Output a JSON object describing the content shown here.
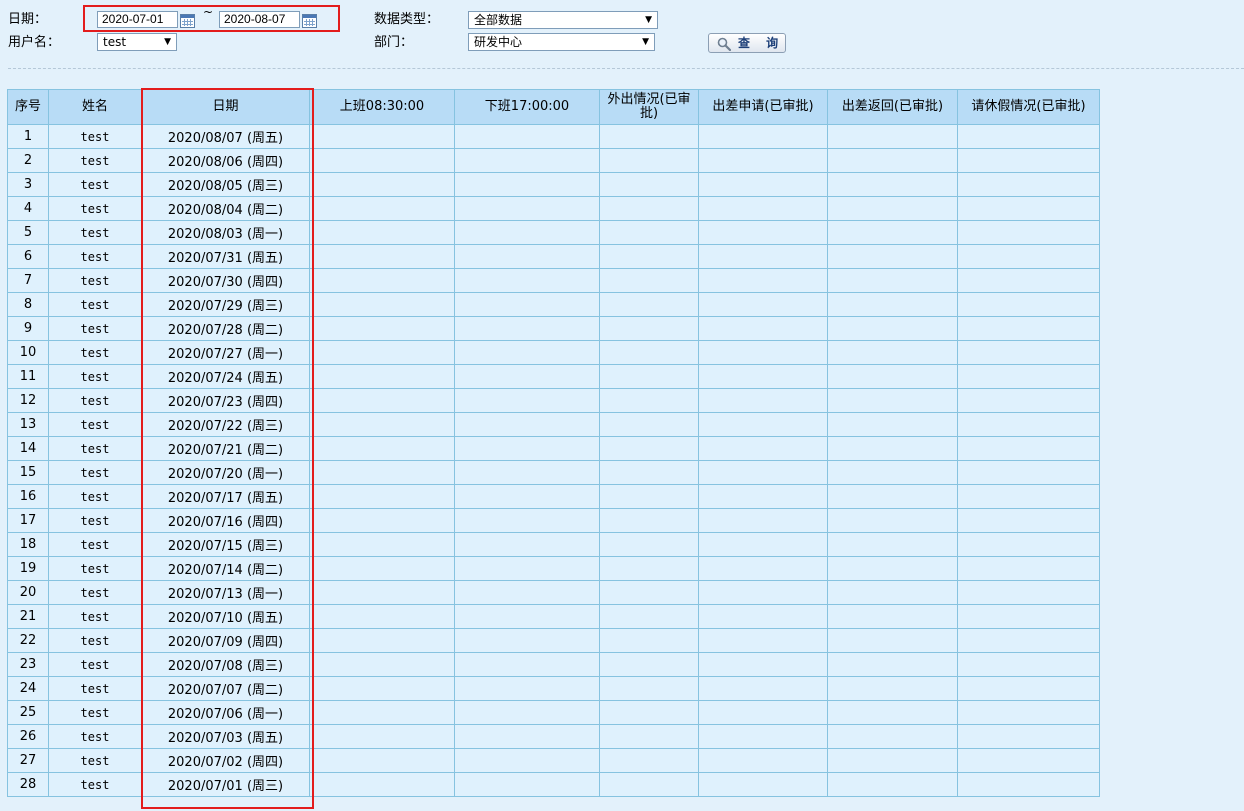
{
  "filters": {
    "date_label": "日期：",
    "start_date": "2020-07-01",
    "date_separator": "~",
    "end_date": "2020-08-07",
    "user_label": "用户名：",
    "user_value": "test",
    "data_type_label": "数据类型：",
    "data_type_value": "全部数据",
    "department_label": "部门：",
    "department_value": "研发中心",
    "query_button": "查 询"
  },
  "table": {
    "headers": [
      "序号",
      "姓名",
      "日期",
      "上班08:30:00",
      "下班17:00:00",
      "外出情况(已审批)",
      "出差申请(已审批)",
      "出差返回(已审批)",
      "请休假情况(已审批)"
    ],
    "rows": [
      [
        "1",
        "test",
        "2020/08/07 (周五)"
      ],
      [
        "2",
        "test",
        "2020/08/06 (周四)"
      ],
      [
        "3",
        "test",
        "2020/08/05 (周三)"
      ],
      [
        "4",
        "test",
        "2020/08/04 (周二)"
      ],
      [
        "5",
        "test",
        "2020/08/03 (周一)"
      ],
      [
        "6",
        "test",
        "2020/07/31 (周五)"
      ],
      [
        "7",
        "test",
        "2020/07/30 (周四)"
      ],
      [
        "8",
        "test",
        "2020/07/29 (周三)"
      ],
      [
        "9",
        "test",
        "2020/07/28 (周二)"
      ],
      [
        "10",
        "test",
        "2020/07/27 (周一)"
      ],
      [
        "11",
        "test",
        "2020/07/24 (周五)"
      ],
      [
        "12",
        "test",
        "2020/07/23 (周四)"
      ],
      [
        "13",
        "test",
        "2020/07/22 (周三)"
      ],
      [
        "14",
        "test",
        "2020/07/21 (周二)"
      ],
      [
        "15",
        "test",
        "2020/07/20 (周一)"
      ],
      [
        "16",
        "test",
        "2020/07/17 (周五)"
      ],
      [
        "17",
        "test",
        "2020/07/16 (周四)"
      ],
      [
        "18",
        "test",
        "2020/07/15 (周三)"
      ],
      [
        "19",
        "test",
        "2020/07/14 (周二)"
      ],
      [
        "20",
        "test",
        "2020/07/13 (周一)"
      ],
      [
        "21",
        "test",
        "2020/07/10 (周五)"
      ],
      [
        "22",
        "test",
        "2020/07/09 (周四)"
      ],
      [
        "23",
        "test",
        "2020/07/08 (周三)"
      ],
      [
        "24",
        "test",
        "2020/07/07 (周二)"
      ],
      [
        "25",
        "test",
        "2020/07/06 (周一)"
      ],
      [
        "26",
        "test",
        "2020/07/03 (周五)"
      ],
      [
        "27",
        "test",
        "2020/07/02 (周四)"
      ],
      [
        "28",
        "test",
        "2020/07/01 (周三)"
      ]
    ]
  },
  "colors": {
    "page_background": "#e3f1fb",
    "header_background": "#b8dcf6",
    "cell_background": "#dff1fd",
    "grid_border": "#86c3e0",
    "highlight_box": "#e31c1c"
  }
}
